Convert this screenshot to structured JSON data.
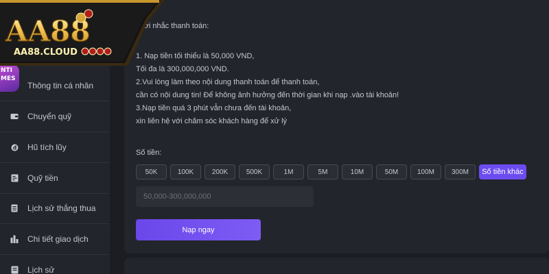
{
  "brand": {
    "logo_text": "AA88",
    "logo_domain": "AA88.CLOUD"
  },
  "promo_badge": {
    "line1": "NTI",
    "line2": "MES"
  },
  "sidebar": {
    "items": [
      {
        "label": "Thông tin cá nhân",
        "icon": "user-icon"
      },
      {
        "label": "Chuyển quỹ",
        "icon": "wallet-icon"
      },
      {
        "label": "Hũ tích lũy",
        "icon": "coin-icon"
      },
      {
        "label": "Quỹ tiền",
        "icon": "fund-icon"
      },
      {
        "label": "Lịch sử thắng thua",
        "icon": "document-icon"
      },
      {
        "label": "Chi tiết giao dịch",
        "icon": "bar-chart-icon"
      },
      {
        "label": "Lịch sử",
        "icon": "history-icon"
      }
    ]
  },
  "notice": {
    "title_visible": "n lời nhắc thanh toán:",
    "lines": [
      "1. Nạp tiền tối thiểu là 50,000 VND,",
      "Tối đa là 300,000,000 VND.",
      "2.Vui lòng làm theo nội dung thanh toán để thanh toán,",
      "cần có nội dung tin! Để không ảnh hưởng đến thời gian khi nạp .vào tài khoản!",
      "3.Nạp tiền quá 3 phút vẫn chưa đến tài khoản,",
      "xin liên hệ với chăm sóc khách hàng để xử lý"
    ]
  },
  "amount": {
    "label": "Số tiền:",
    "chips": [
      "50K",
      "100K",
      "200K",
      "500K",
      "1M",
      "5M",
      "10M",
      "50M",
      "100M",
      "300M"
    ],
    "other_label": "Số tiền khác",
    "input_placeholder": "50,000-300,000,000",
    "input_value": ""
  },
  "submit_label": "Nạp ngay",
  "colors": {
    "accent": "#6c4cf0",
    "panel": "#22252b",
    "background": "#1b1d22",
    "logo_gold": "#f2c14e"
  }
}
